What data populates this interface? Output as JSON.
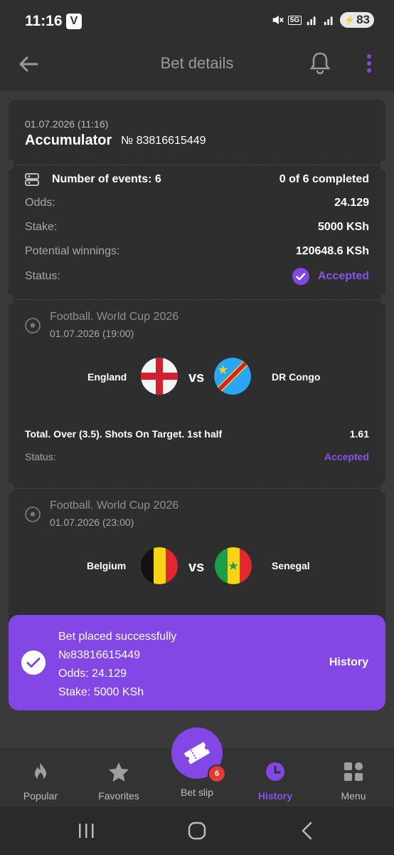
{
  "status_bar": {
    "time": "11:16",
    "app_badge": "V",
    "network": "5G",
    "battery": "83"
  },
  "header": {
    "title": "Bet details"
  },
  "bet": {
    "datetime": "01.07.2026 (11:16)",
    "type": "Accumulator",
    "number": "№ 83816615449",
    "events_label": "Number of events: 6",
    "completed": "0 of 6 completed",
    "odds_label": "Odds:",
    "odds_value": "24.129",
    "stake_label": "Stake:",
    "stake_value": "5000 KSh",
    "winnings_label": "Potential winnings:",
    "winnings_value": "120648.6 KSh",
    "status_label": "Status:",
    "status_value": "Accepted"
  },
  "events": [
    {
      "competition": "Football. World Cup 2026",
      "date": "01.07.2026 (19:00)",
      "home": "England",
      "away": "DR Congo",
      "vs": "vs",
      "market": "Total. Over (3.5). Shots On Target. 1st half",
      "odds": "1.61",
      "status_label": "Status:",
      "status_value": "Accepted"
    },
    {
      "competition": "Football. World Cup 2026",
      "date": "01.07.2026 (23:00)",
      "home": "Belgium",
      "away": "Senegal",
      "vs": "vs"
    }
  ],
  "toast": {
    "line1": "Bet placed successfully",
    "line2": "№83816615449",
    "line3": "Odds: 24.129",
    "line4": "Stake: 5000 KSh",
    "action": "History"
  },
  "nav": {
    "popular": "Popular",
    "favorites": "Favorites",
    "betslip": "Bet slip",
    "betslip_count": "6",
    "history": "History",
    "menu": "Menu"
  },
  "colors": {
    "accent": "#8247e5",
    "background": "#3a3a3a",
    "card": "#2e2e2e"
  }
}
